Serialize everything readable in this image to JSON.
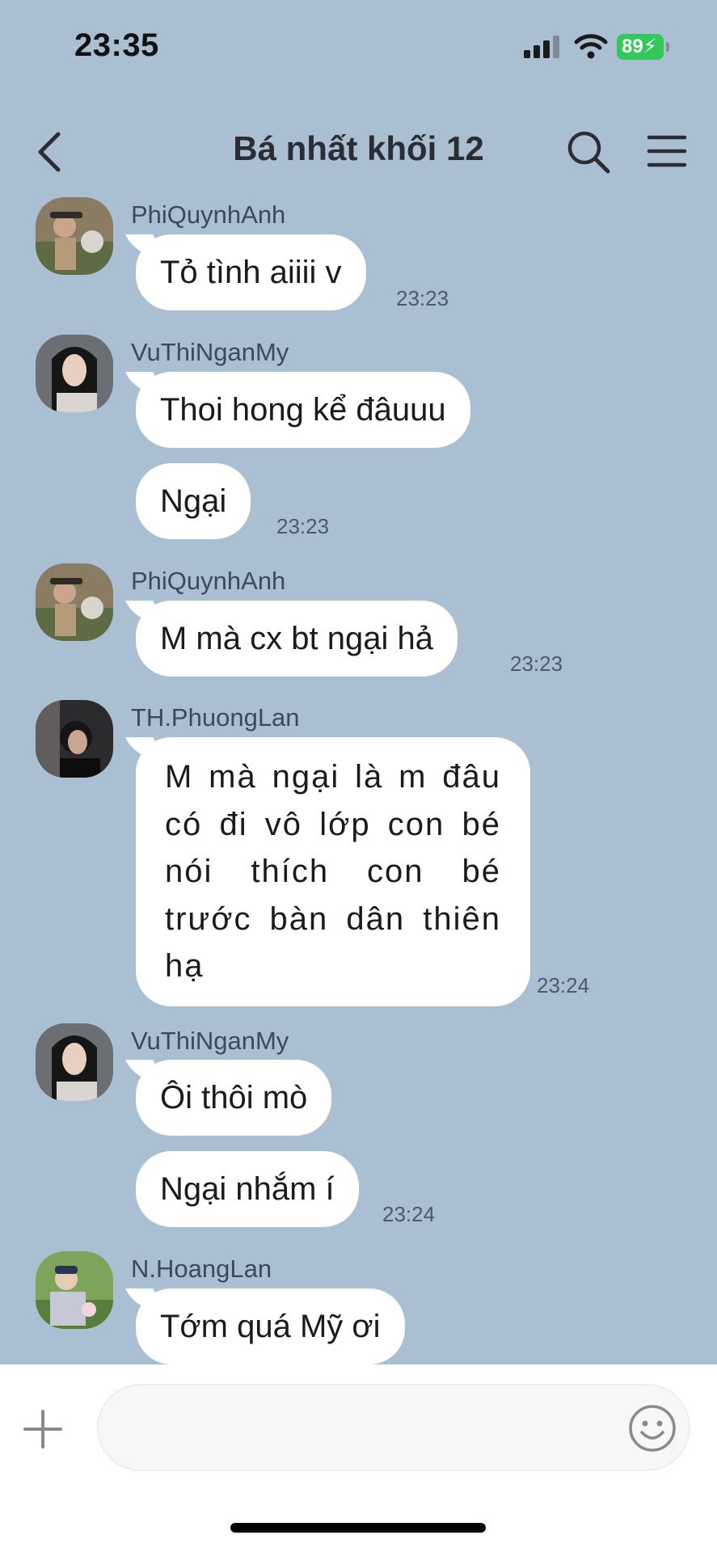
{
  "status_bar": {
    "time": "23:35",
    "battery": "89"
  },
  "header": {
    "title": "Bá nhất khối 12"
  },
  "messages": [
    {
      "sender": "PhiQuynhAnh",
      "lines": [
        "Tỏ tình aiiii v"
      ],
      "time": "23:23"
    },
    {
      "sender": "VuThiNganMy",
      "lines": [
        "Thoi hong kể đâuuu",
        "Ngại"
      ],
      "time": "23:23"
    },
    {
      "sender": "PhiQuynhAnh",
      "lines": [
        "M mà cx bt ngại hả"
      ],
      "time": "23:23"
    },
    {
      "sender": "TH.PhuongLan",
      "lines": [
        "M mà ngại là m đâu có đi vô lớp con bé nói thích con bé trước bàn dân thiên hạ"
      ],
      "time": "23:24"
    },
    {
      "sender": "VuThiNganMy",
      "lines": [
        "Ôi thôi mò",
        "Ngại nhắm í"
      ],
      "time": "23:24"
    },
    {
      "sender": "N.HoangLan",
      "lines": [
        "Tớm quá Mỹ ơi"
      ],
      "time": ""
    }
  ],
  "composer": {
    "placeholder": ""
  },
  "colors": {
    "background": "#abbfd2",
    "bubble": "#ffffff",
    "battery": "#34c759"
  },
  "icons": [
    "back-icon",
    "search-icon",
    "menu-icon",
    "plus-icon",
    "emoji-icon"
  ]
}
